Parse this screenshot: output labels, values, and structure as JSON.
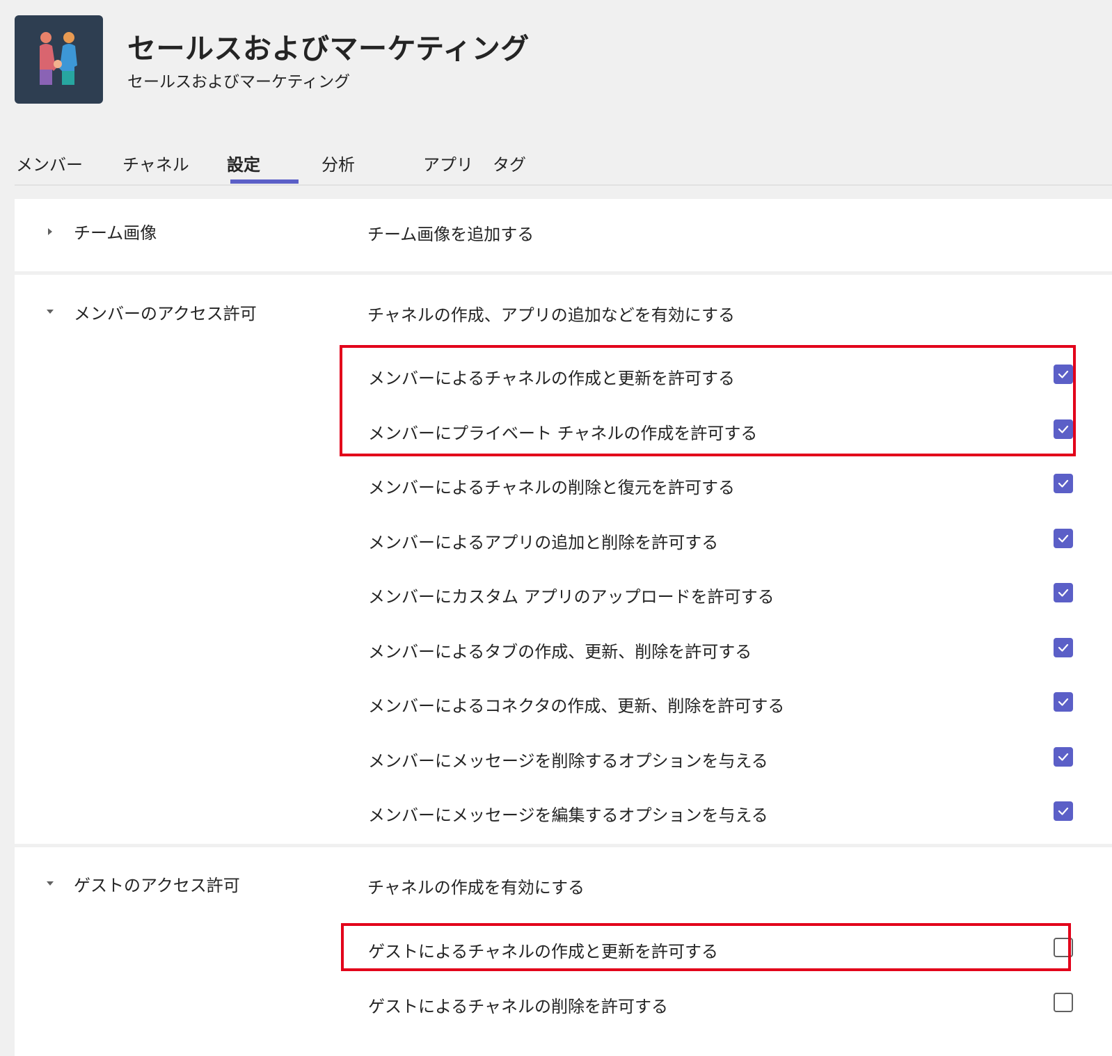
{
  "team": {
    "avatar_icon": "team-people-icon",
    "title": "セールスおよびマーケティング",
    "subtitle": "セールスおよびマーケティング"
  },
  "tabs": [
    {
      "label": "メンバー",
      "active": false
    },
    {
      "label": "チャネル",
      "active": false
    },
    {
      "label": "設定",
      "active": true
    },
    {
      "label": "分析",
      "active": false
    },
    {
      "label": "アプリ",
      "active": false
    },
    {
      "label": "タグ",
      "active": false
    }
  ],
  "colors": {
    "accent": "#5b5fc7",
    "highlight": "#e2001a",
    "avatar_bg": "#2e3e51"
  },
  "sections": {
    "team_image": {
      "label": "チーム画像",
      "description": "チーム画像を追加する",
      "expanded": false
    },
    "member_permissions": {
      "label": "メンバーのアクセス許可",
      "description": "チャネルの作成、アプリの追加などを有効にする",
      "expanded": true,
      "options": [
        {
          "label": "メンバーによるチャネルの作成と更新を許可する",
          "checked": true
        },
        {
          "label": "メンバーにプライベート チャネルの作成を許可する",
          "checked": true
        },
        {
          "label": "メンバーによるチャネルの削除と復元を許可する",
          "checked": true
        },
        {
          "label": "メンバーによるアプリの追加と削除を許可する",
          "checked": true
        },
        {
          "label": "メンバーにカスタム アプリのアップロードを許可する",
          "checked": true
        },
        {
          "label": "メンバーによるタブの作成、更新、削除を許可する",
          "checked": true
        },
        {
          "label": "メンバーによるコネクタの作成、更新、削除を許可する",
          "checked": true
        },
        {
          "label": "メンバーにメッセージを削除するオプションを与える",
          "checked": true
        },
        {
          "label": "メンバーにメッセージを編集するオプションを与える",
          "checked": true
        }
      ]
    },
    "guest_permissions": {
      "label": "ゲストのアクセス許可",
      "description": "チャネルの作成を有効にする",
      "expanded": true,
      "options": [
        {
          "label": "ゲストによるチャネルの作成と更新を許可する",
          "checked": false
        },
        {
          "label": "ゲストによるチャネルの削除を許可する",
          "checked": false
        }
      ]
    }
  }
}
